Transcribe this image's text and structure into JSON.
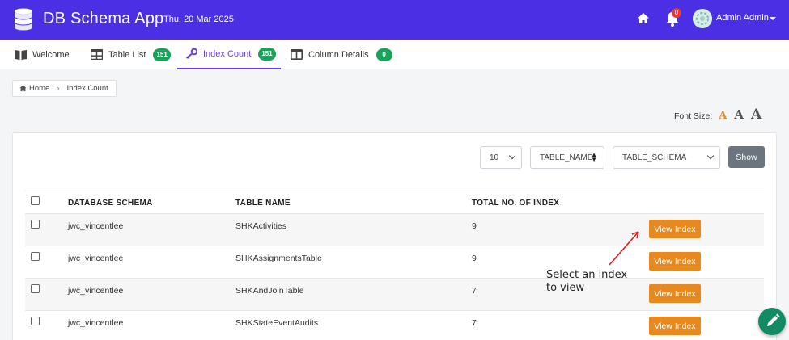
{
  "app": {
    "title": "DB Schema App",
    "date": "Thu, 20 Mar 2025"
  },
  "header": {
    "notifications_count": "0",
    "user_name": "Admin Admin"
  },
  "tabs": [
    {
      "label": "Welcome",
      "icon": "book-icon"
    },
    {
      "label": "Table List",
      "icon": "table-icon",
      "badge": "151"
    },
    {
      "label": "Index Count",
      "icon": "key-icon",
      "badge": "151",
      "active": true
    },
    {
      "label": "Column Details",
      "icon": "columns-icon",
      "badge": "0"
    }
  ],
  "breadcrumb": {
    "home": "Home",
    "current": "Index Count"
  },
  "font_size": {
    "label": "Font Size:",
    "small": "A",
    "medium": "A",
    "large": "A"
  },
  "controls": {
    "page_size": "10",
    "sort_field": "TABLE_NAME",
    "schema_filter": "TABLE_SCHEMA",
    "show_label": "Show"
  },
  "table": {
    "headers": {
      "schema": "DATABASE SCHEMA",
      "table": "TABLE NAME",
      "total": "TOTAL NO. OF INDEX"
    },
    "rows": [
      {
        "schema": "jwc_vincentlee",
        "table": "SHKActivities",
        "total": "9",
        "action": "View Index"
      },
      {
        "schema": "jwc_vincentlee",
        "table": "SHKAssignmentsTable",
        "total": "9",
        "action": "View Index"
      },
      {
        "schema": "jwc_vincentlee",
        "table": "SHKAndJoinTable",
        "total": "7",
        "action": "View Index"
      },
      {
        "schema": "jwc_vincentlee",
        "table": "SHKStateEventAudits",
        "total": "7",
        "action": "View Index"
      }
    ]
  },
  "annotation": {
    "line1": "Select an index",
    "line2": "to view"
  },
  "colors": {
    "brand": "#4a2fe4",
    "accent": "#6a3de8",
    "badge": "#19a35a",
    "action": "#e8891f",
    "fab": "#138a63"
  }
}
